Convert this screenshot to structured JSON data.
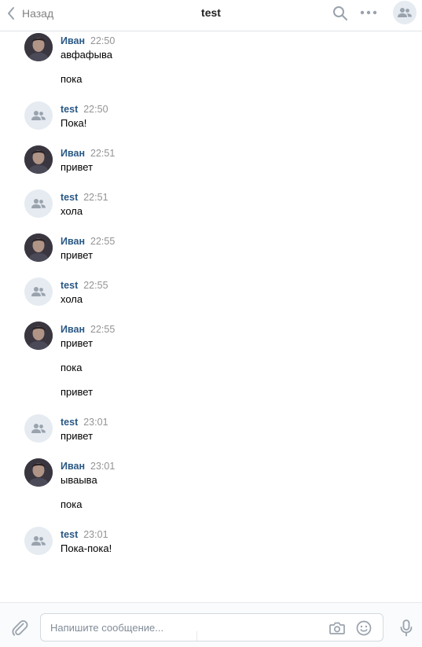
{
  "header": {
    "back_label": "Назад",
    "title": "test",
    "icons": [
      "chevron-left-icon",
      "search-icon",
      "more-icon",
      "group-icon"
    ]
  },
  "messages": [
    {
      "author": "Иван",
      "time": "22:50",
      "avatar": "photo",
      "lines": [
        "авфафыва",
        "пока"
      ]
    },
    {
      "author": "test",
      "time": "22:50",
      "avatar": "group-placeholder",
      "lines": [
        "Пока!"
      ]
    },
    {
      "author": "Иван",
      "time": "22:51",
      "avatar": "photo",
      "lines": [
        "привет"
      ]
    },
    {
      "author": "test",
      "time": "22:51",
      "avatar": "group-placeholder",
      "lines": [
        "хола"
      ]
    },
    {
      "author": "Иван",
      "time": "22:55",
      "avatar": "photo",
      "lines": [
        "привет"
      ]
    },
    {
      "author": "test",
      "time": "22:55",
      "avatar": "group-placeholder",
      "lines": [
        "хола"
      ]
    },
    {
      "author": "Иван",
      "time": "22:55",
      "avatar": "photo",
      "lines": [
        "привет",
        "пока",
        "привет"
      ]
    },
    {
      "author": "test",
      "time": "23:01",
      "avatar": "group-placeholder",
      "lines": [
        "привет"
      ]
    },
    {
      "author": "Иван",
      "time": "23:01",
      "avatar": "photo",
      "lines": [
        "ываыва",
        "пока"
      ]
    },
    {
      "author": "test",
      "time": "23:01",
      "avatar": "group-placeholder",
      "lines": [
        "Пока-пока!"
      ]
    }
  ],
  "composer": {
    "placeholder": "Напишите сообщение...",
    "icons": [
      "attach-icon",
      "camera-icon",
      "smile-icon",
      "microphone-icon"
    ]
  },
  "colors": {
    "author": "#2a5885",
    "time": "#939393",
    "placeholder_avatar_bg": "#e5ebf1",
    "icon": "#99a2ad"
  }
}
